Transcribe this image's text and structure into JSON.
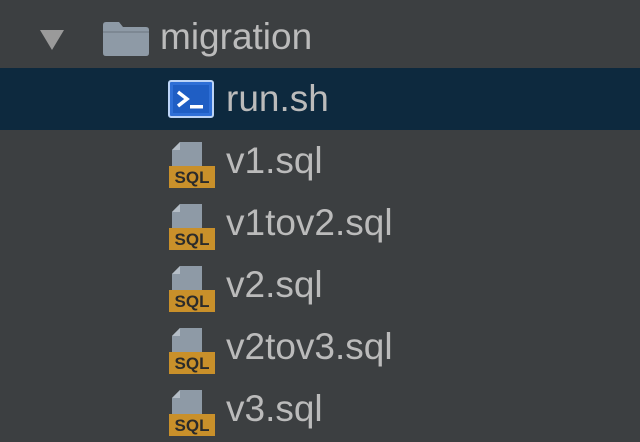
{
  "tree": {
    "folder": {
      "name": "migration",
      "expanded": true,
      "icon": "folder-icon"
    },
    "files": [
      {
        "name": "run.sh",
        "icon": "shell-script-icon",
        "selected": true
      },
      {
        "name": "v1.sql",
        "icon": "sql-file-icon",
        "selected": false
      },
      {
        "name": "v1tov2.sql",
        "icon": "sql-file-icon",
        "selected": false
      },
      {
        "name": "v2.sql",
        "icon": "sql-file-icon",
        "selected": false
      },
      {
        "name": "v2tov3.sql",
        "icon": "sql-file-icon",
        "selected": false
      },
      {
        "name": "v3.sql",
        "icon": "sql-file-icon",
        "selected": false
      }
    ],
    "sql_badge_text": "SQL",
    "colors": {
      "background": "#3c3f41",
      "selection": "#0d293e",
      "text": "#bbbbbb",
      "folder": "#8e9aa6",
      "sql_badge": "#c9902a",
      "shell_icon": "#3c7ee0"
    }
  }
}
